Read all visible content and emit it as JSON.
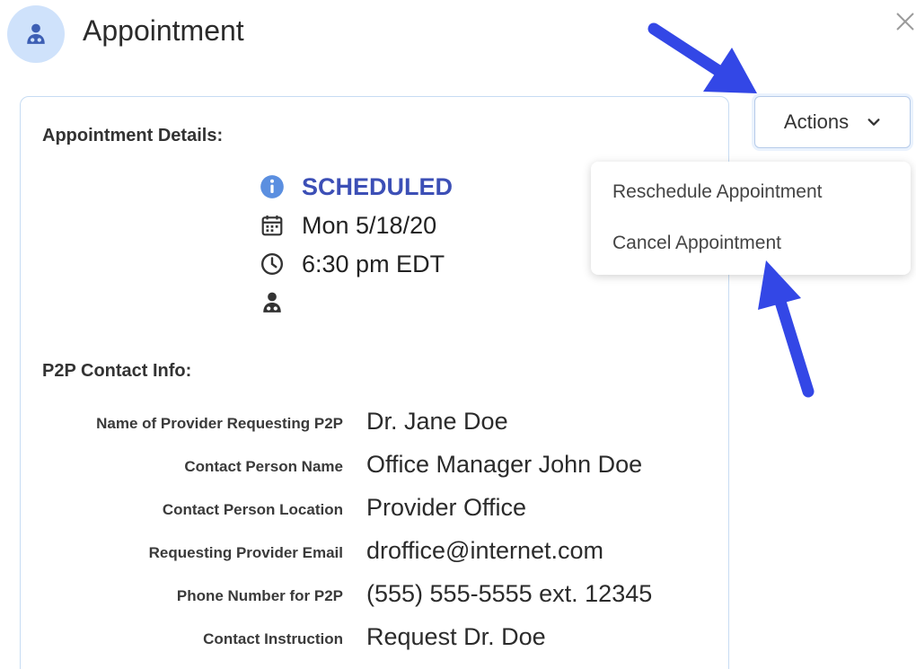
{
  "dialog": {
    "title": "Appointment",
    "close_icon": "close-icon",
    "header_icon": "doctor-icon"
  },
  "details": {
    "section_title": "Appointment Details:",
    "status": "SCHEDULED",
    "date": "Mon 5/18/20",
    "time": "6:30 pm EDT",
    "provider": "",
    "status_color": "#3c4fb6"
  },
  "contact": {
    "section_title": "P2P Contact Info:",
    "rows": [
      {
        "label": "Name of Provider Requesting P2P",
        "value": "Dr. Jane Doe"
      },
      {
        "label": "Contact Person Name",
        "value": "Office Manager John Doe"
      },
      {
        "label": "Contact Person Location",
        "value": "Provider Office"
      },
      {
        "label": "Requesting Provider Email",
        "value": "droffice@internet.com"
      },
      {
        "label": "Phone Number for P2P",
        "value": "(555) 555-5555 ext. 12345"
      },
      {
        "label": "Contact Instruction",
        "value": "Request Dr. Doe"
      }
    ]
  },
  "actions": {
    "label": "Actions",
    "menu": [
      {
        "label": "Reschedule Appointment"
      },
      {
        "label": "Cancel Appointment"
      }
    ]
  },
  "annotations": {
    "arrow_color": "#3347e6"
  }
}
